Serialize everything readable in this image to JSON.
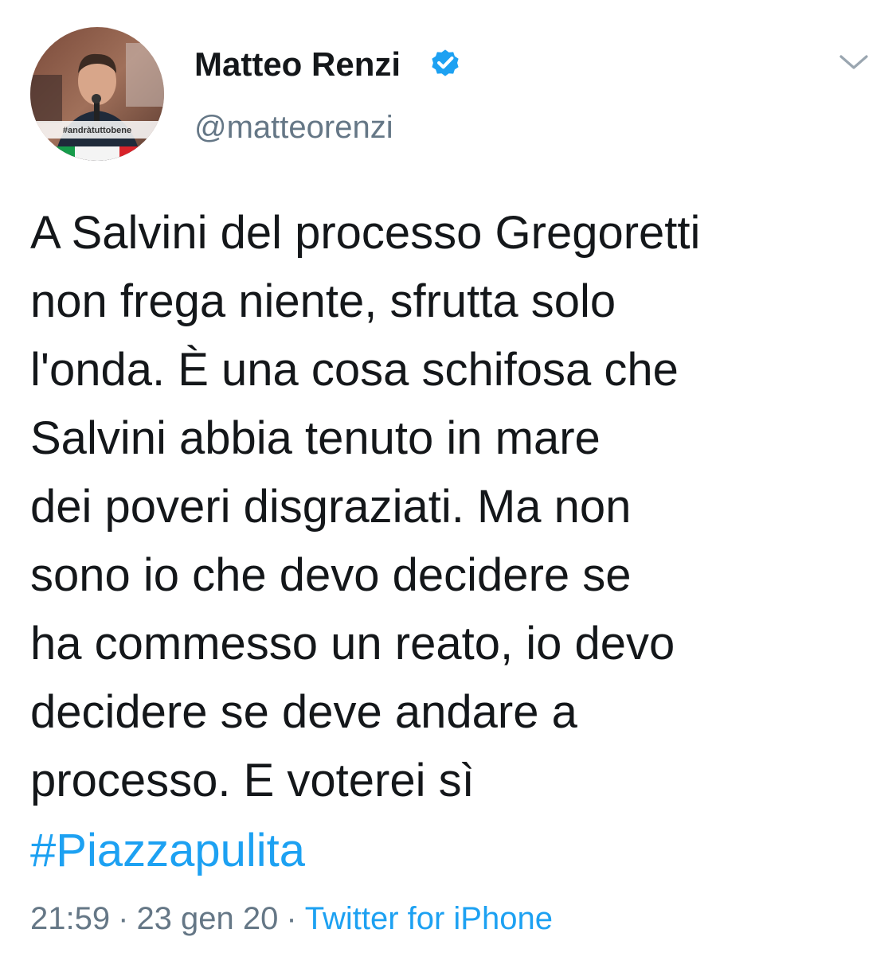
{
  "user": {
    "display_name": "Matteo Renzi",
    "handle": "@matteorenzi",
    "avatar_caption": "#andràtuttobene",
    "verified": true
  },
  "tweet": {
    "text": "A Salvini del processo Gregoretti\nnon frega niente, sfrutta solo\nl'onda. È una cosa schifosa che\nSalvini abbia tenuto in mare\ndei poveri disgraziati. Ma non\nsono io che devo decidere se\nha commesso un reato, io devo\ndecidere se deve andare a\nprocesso. E voterei sì",
    "hashtag": "#Piazzapulita",
    "time": "21:59",
    "date": "23 gen 20",
    "separator": "·",
    "source": "Twitter for iPhone"
  },
  "icons": {
    "verified": "verified-badge-icon",
    "menu": "chevron-down-icon"
  },
  "colors": {
    "link": "#1da1f2",
    "secondary_text": "#657786",
    "primary_text": "#14171a"
  }
}
